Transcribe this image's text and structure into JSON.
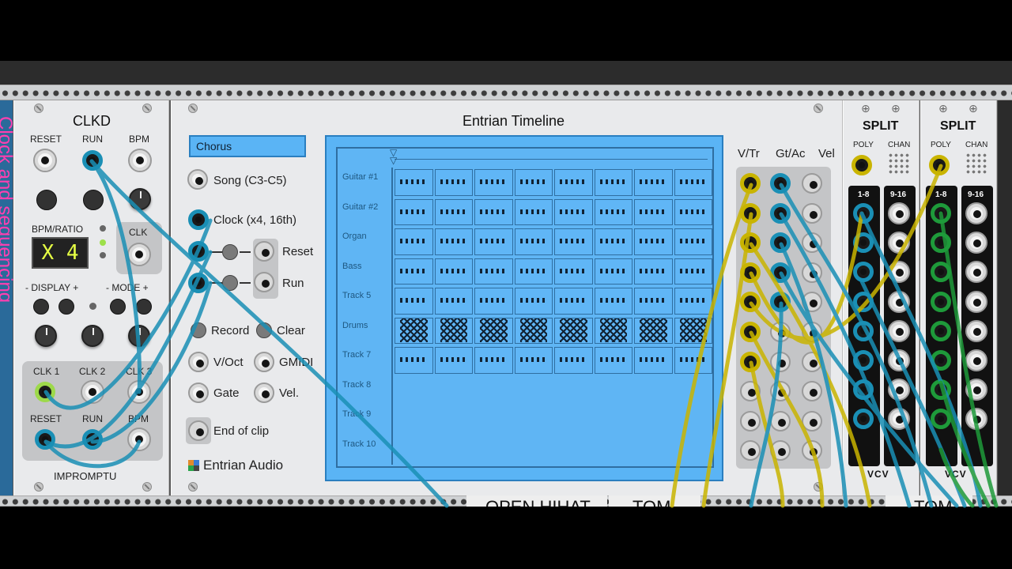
{
  "clkd": {
    "title": "CLKD",
    "top_labels": [
      "RESET",
      "RUN",
      "BPM"
    ],
    "bpm_ratio_label": "BPM/RATIO",
    "display_value": "X 4",
    "clk_label": "CLK",
    "display_label": "- DISPLAY +",
    "mode_label": "- MODE +",
    "clk_labels": [
      "CLK 1",
      "CLK 2",
      "CLK 3"
    ],
    "bottom_labels": [
      "RESET",
      "RUN",
      "BPM"
    ],
    "brand": "IMPROMPTU"
  },
  "left_strip_text": "Clock and sequencing",
  "entrian": {
    "title": "Entrian Timeline",
    "clip_name": "Chorus",
    "song_label": "Song (C3-C5)",
    "clock_label": "Clock (x4, 16th)",
    "reset_label": "Reset",
    "run_label": "Run",
    "record_label": "Record",
    "clear_label": "Clear",
    "voct_label": "V/Oct",
    "gmidi_label": "GMIDI",
    "gate_label": "Gate",
    "vel_label": "Vel.",
    "end_label": "End of clip",
    "brand": "Entrian Audio",
    "tracks": [
      "Guitar #1",
      "Guitar #2",
      "Organ",
      "Bass",
      "Track 5",
      "Drums",
      "Track 7",
      "Track 8",
      "Track 9",
      "Track 10"
    ]
  },
  "outputs": {
    "headers": [
      "V/Tr",
      "Gt/Ac",
      "Vel"
    ]
  },
  "split1": {
    "title": "SPLIT",
    "poly_label": "POLY",
    "chan_label": "CHAN",
    "col1": "1-8",
    "col2": "9-16",
    "brand": "VCV"
  },
  "split2": {
    "title": "SPLIT",
    "poly_label": "POLY",
    "chan_label": "CHAN",
    "col1": "1-8",
    "col2": "9-16",
    "brand": "VCV"
  },
  "bottom_row": {
    "open_hihat": "OPEN HIHAT",
    "tom1": "TOM",
    "tom2": "TOM"
  },
  "colors": {
    "cable_blue": "#1a8fb5",
    "cable_yellow": "#c9b400",
    "cable_green": "#1e9a3a",
    "timeline_bg": "#5ab4f5"
  }
}
